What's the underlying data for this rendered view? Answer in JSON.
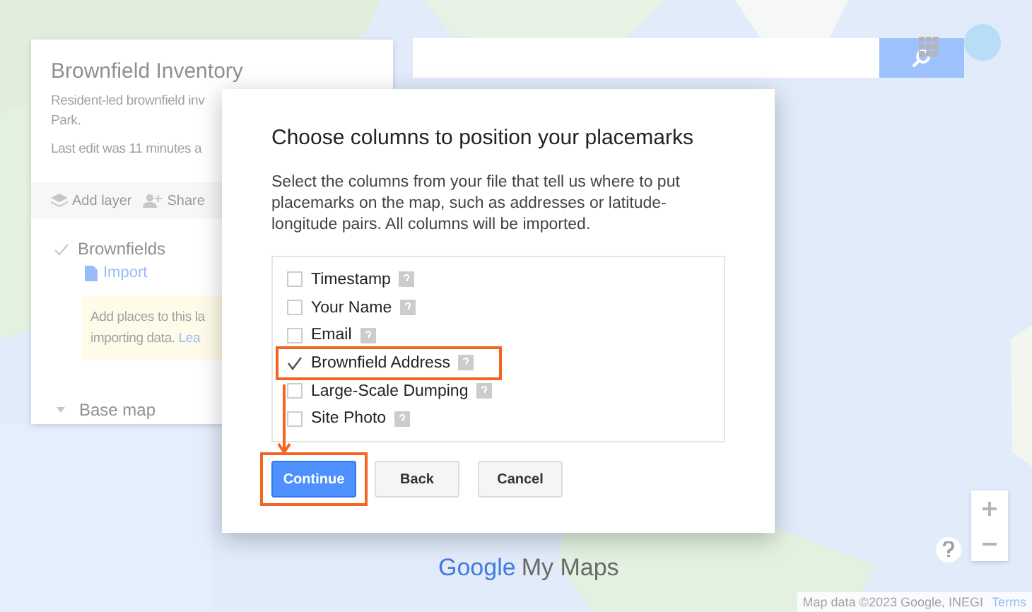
{
  "panel": {
    "title": "Brownfield Inventory",
    "description_lines": [
      "Resident-led brownfield inv",
      "Park."
    ],
    "last_edit": "Last edit was 11 minutes a",
    "toolbar": [
      {
        "kind": "layers",
        "label": "Add layer"
      },
      {
        "kind": "share",
        "label": "Share"
      }
    ],
    "layer": {
      "name": "Brownfields",
      "checked": true,
      "import_label": "Import",
      "hint_text": "Add places to this la",
      "hint_text_2": "importing data.",
      "hint_link": "Lea"
    },
    "base_map": "Base map"
  },
  "map": {
    "logo_brand": "Google",
    "logo_product": "My Maps",
    "attribution": "Map data ©2023 Google, INEGI",
    "terms": "Terms"
  },
  "dialog": {
    "title": "Choose columns to position your placemarks",
    "body": "Select the columns from your file that tell us where to put placemarks on the map, such as addresses or latitude-longitude pairs. All columns will be imported.",
    "columns": [
      {
        "label": "Timestamp",
        "checked": false,
        "highlighted": false
      },
      {
        "label": "Your Name",
        "checked": false,
        "highlighted": false
      },
      {
        "label": "Email",
        "checked": false,
        "highlighted": false
      },
      {
        "label": "Brownfield Address",
        "checked": true,
        "highlighted": true
      },
      {
        "label": "Large-Scale Dumping",
        "checked": false,
        "highlighted": false
      },
      {
        "label": "Site Photo",
        "checked": false,
        "highlighted": false
      }
    ],
    "buttons": [
      {
        "label": "Continue",
        "kind": "primary",
        "highlighted": true
      },
      {
        "label": "Back",
        "kind": "secondary",
        "highlighted": false
      },
      {
        "label": "Cancel",
        "kind": "secondary",
        "highlighted": false
      }
    ]
  }
}
